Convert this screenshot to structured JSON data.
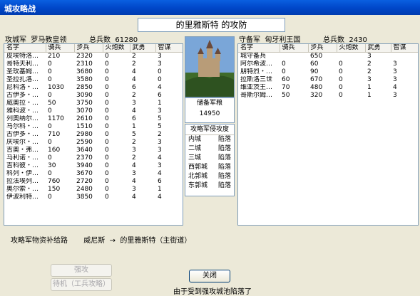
{
  "window": {
    "title": "城攻略战"
  },
  "siege_title": "的里雅斯特 的攻防",
  "attacker": {
    "label": "攻城军",
    "name": "罗马教皇领",
    "total_label": "总兵数",
    "total": "61280",
    "columns": [
      "名字",
      "骑兵",
      "步兵",
      "火炮数",
      "武勇",
      "智谋"
    ],
    "rows": [
      [
        "皮埃特洛…",
        "210",
        "2320",
        "0",
        "2",
        "3"
      ],
      [
        "哥特夫利…",
        "0",
        "2310",
        "0",
        "2",
        "3"
      ],
      [
        "圣玫基姆…",
        "0",
        "3680",
        "0",
        "4",
        "0"
      ],
      [
        "圣拉扎洛…",
        "0",
        "3580",
        "0",
        "4",
        "0"
      ],
      [
        "尼科洛・…",
        "1030",
        "2850",
        "0",
        "6",
        "4"
      ],
      [
        "古伊多・…",
        "0",
        "3090",
        "0",
        "2",
        "6"
      ],
      [
        "威奥拉・…",
        "50",
        "3750",
        "0",
        "3",
        "1"
      ],
      [
        "雅科波・…",
        "0",
        "3070",
        "0",
        "4",
        "3"
      ],
      [
        "列奥纳尔…",
        "1170",
        "2610",
        "0",
        "6",
        "5"
      ],
      [
        "马尔科・…",
        "0",
        "1510",
        "0",
        "1",
        "5"
      ],
      [
        "古伊多・…",
        "710",
        "2980",
        "0",
        "5",
        "2"
      ],
      [
        "庆埃尔・…",
        "0",
        "2590",
        "0",
        "2",
        "3"
      ],
      [
        "吉奥・弗…",
        "160",
        "3640",
        "0",
        "3",
        "3"
      ],
      [
        "马利诺・…",
        "0",
        "2370",
        "0",
        "2",
        "4"
      ],
      [
        "吉科彼・…",
        "30",
        "3940",
        "0",
        "4",
        "3"
      ],
      [
        "科列・伊…",
        "0",
        "3670",
        "0",
        "3",
        "4"
      ],
      [
        "拉法埃列…",
        "760",
        "2720",
        "0",
        "4",
        "6"
      ],
      [
        "奥尔索・…",
        "150",
        "2480",
        "0",
        "3",
        "1"
      ],
      [
        "伊波利特…",
        "0",
        "3850",
        "0",
        "4",
        "4"
      ]
    ]
  },
  "defender": {
    "label": "守备军",
    "name": "匈牙利王国",
    "total_label": "总兵数",
    "total": "2430",
    "columns": [
      "名字",
      "骑兵",
      "步兵",
      "火炮数",
      "武勇",
      "智谋"
    ],
    "rows": [
      [
        "城守备兵",
        "",
        "650",
        "",
        "3",
        ""
      ],
      [
        "阿尔希波…",
        "0",
        "60",
        "0",
        "2",
        "3"
      ],
      [
        "朋特烈・…",
        "0",
        "90",
        "0",
        "2",
        "3"
      ],
      [
        "拉斯洛三世",
        "60",
        "670",
        "0",
        "3",
        "3"
      ],
      [
        "维亚茨王…",
        "70",
        "480",
        "0",
        "1",
        "4"
      ],
      [
        "哥斯尔姆…",
        "50",
        "320",
        "0",
        "1",
        "3"
      ]
    ]
  },
  "reserve": {
    "label": "储备军粮",
    "value": "14950"
  },
  "invasion": {
    "label": "攻略军侵攻度",
    "rows": [
      {
        "place": "内城",
        "status": "陷落"
      },
      {
        "place": "二城",
        "status": "陷落"
      },
      {
        "place": "三城",
        "status": "陷落"
      },
      {
        "place": "西郭城",
        "status": "陷落"
      },
      {
        "place": "北郭城",
        "status": "陷落"
      },
      {
        "place": "东郭城",
        "status": "陷落"
      }
    ]
  },
  "supply": {
    "label": "攻略军物资补给路",
    "from": "威尼斯",
    "arrow": "→",
    "to": "的里雅斯特（主街道）"
  },
  "buttons": {
    "attack": "强攻",
    "wait": "待机（工兵攻略）",
    "close": "关闭"
  },
  "status_text": "由于受到强攻城池陷落了"
}
